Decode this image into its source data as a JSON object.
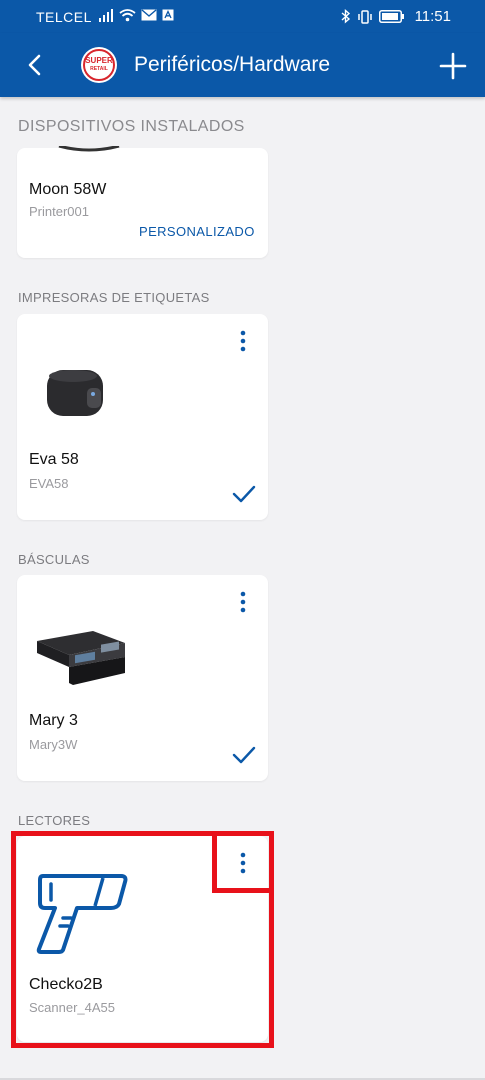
{
  "status_bar": {
    "carrier": "TELCEL",
    "time": "11:51"
  },
  "app_bar": {
    "title": "Periféricos/Hardware",
    "logo_text_top": "SUPER",
    "logo_text_bottom": "RETAIL"
  },
  "sections": {
    "installed": "DISPOSITIVOS INSTALADOS",
    "label_printers": "IMPRESORAS DE ETIQUETAS",
    "scales": "BÁSCULAS",
    "readers": "LECTORES"
  },
  "devices": {
    "printer": {
      "name": "Moon 58W",
      "model": "Printer001",
      "action": "PERSONALIZADO"
    },
    "label_printer": {
      "name": "Eva 58",
      "model": "EVA58"
    },
    "scale": {
      "name": "Mary 3",
      "model": "Mary3W"
    },
    "reader": {
      "name": "Checko2B",
      "model": "Scanner_4A55"
    }
  },
  "colors": {
    "primary": "#0b58a8",
    "highlight": "#e8111a",
    "background": "#f2f2f4"
  },
  "icons": [
    "back-arrow-icon",
    "plus-icon",
    "more-vert-icon",
    "check-icon",
    "barcode-scanner-icon"
  ]
}
